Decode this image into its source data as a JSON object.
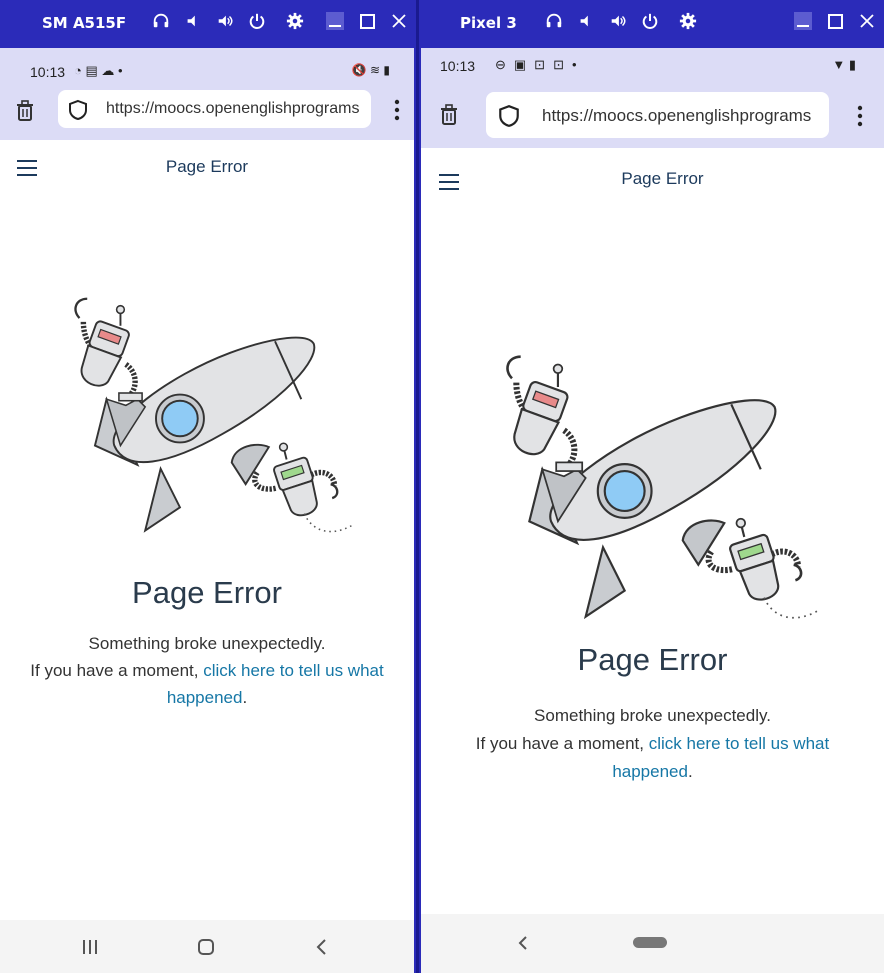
{
  "left": {
    "device": "SM A515F",
    "time": "10:13",
    "url": "https://moocs.openenglishprograms",
    "page_title": "Page Error",
    "error_heading": "Page Error",
    "error_line1": "Something broke unexpectedly.",
    "error_line2_prefix": "If you have a moment,",
    "error_link": "click here to tell us what happened",
    "error_line2_suffix": "."
  },
  "right": {
    "device": "Pixel 3",
    "time": "10:13",
    "url": "https://moocs.openenglishprograms",
    "page_title": "Page Error",
    "error_heading": "Page Error",
    "error_line1": "Something broke unexpectedly.",
    "error_line2_prefix": "If you have a moment,",
    "error_link": "click here to tell us what happened",
    "error_line2_suffix": "."
  },
  "colors": {
    "window_frame": "#2b2bb9",
    "chrome_bar": "#dcdcf6",
    "title_text": "#1c3a5c",
    "link": "#1677a6"
  },
  "icons": [
    "headset-icon",
    "volume-down-icon",
    "volume-up-icon",
    "power-icon",
    "settings-icon",
    "minimize-icon",
    "maximize-icon",
    "close-icon",
    "delete-icon",
    "shield-icon",
    "more-icon",
    "menu-icon",
    "recents-icon",
    "home-icon",
    "back-icon"
  ]
}
